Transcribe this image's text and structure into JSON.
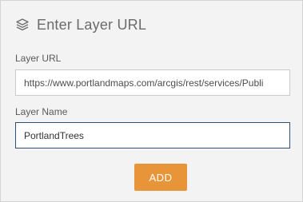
{
  "header": {
    "icon": "layers-icon",
    "title": "Enter Layer URL"
  },
  "layer_url": {
    "label": "Layer URL",
    "value": "https://www.portlandmaps.com/arcgis/rest/services/Publi"
  },
  "layer_name": {
    "label": "Layer Name",
    "value": "PortlandTrees"
  },
  "add_button": {
    "label": "ADD",
    "color": "#e8953a"
  }
}
